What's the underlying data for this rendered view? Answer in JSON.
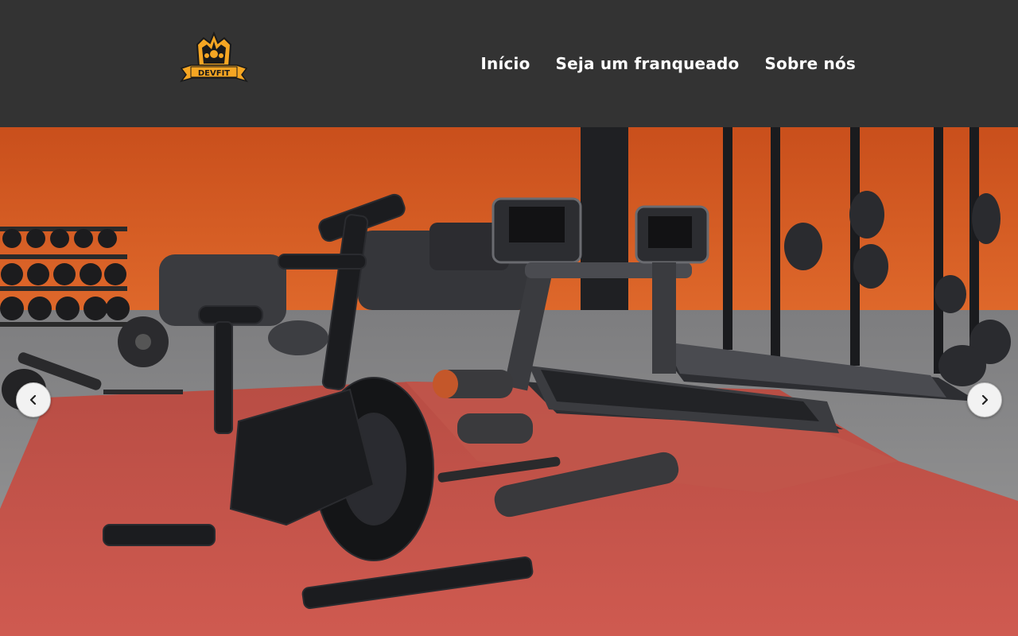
{
  "brand": {
    "logo_text": "DEVFIT",
    "logo_icon": "crown-logo-icon",
    "accent": "#f5a623"
  },
  "nav": {
    "items": [
      {
        "label": "Início"
      },
      {
        "label": "Seja um franqueado"
      },
      {
        "label": "Sobre nós"
      }
    ]
  },
  "carousel": {
    "slide_description_icon": "gym-equipment-photo",
    "prev_icon": "chevron-left-icon",
    "next_icon": "chevron-right-icon"
  },
  "colors": {
    "header_bg": "#333333",
    "wall": "#d9612a",
    "mat": "#c8544a"
  }
}
